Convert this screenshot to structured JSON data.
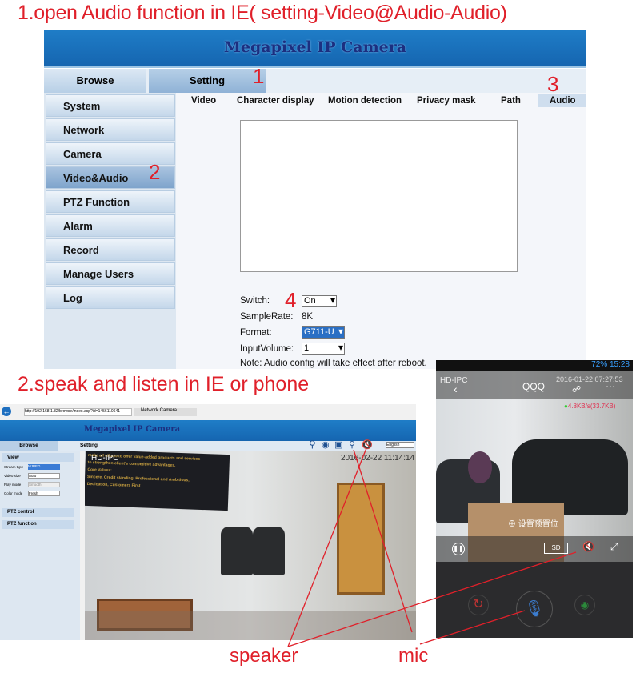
{
  "step1_title": "1.open Audio function in IE( setting-Video@Audio-Audio)",
  "step2_title": "2.speak and listen in IE or phone",
  "markers": [
    "1",
    "2",
    "3",
    "4"
  ],
  "app": {
    "title": "Megapixel IP Camera",
    "tabs": [
      "Browse",
      "Setting"
    ]
  },
  "sidebar": {
    "items": [
      "System",
      "Network",
      "Camera",
      "Video&Audio",
      "PTZ Function",
      "Alarm",
      "Record",
      "Manage Users",
      "Log"
    ],
    "active": "Video&Audio"
  },
  "subtabs": {
    "items": [
      "Video",
      "Character display",
      "Motion detection",
      "Privacy mask",
      "Path",
      "Audio"
    ],
    "active": "Audio"
  },
  "audio_form": {
    "switch_label": "Switch:",
    "switch_value": "On",
    "samplerate_label": "SampleRate:",
    "samplerate_value": "8K",
    "format_label": "Format:",
    "format_value": "G711-U",
    "volume_label": "InputVolume:",
    "volume_value": "1",
    "note": "Note: Audio config will take effect after reboot."
  },
  "browser": {
    "url": "http://192.168.1.32/browse/index.asp?id=1456110641",
    "tab_title": "Network Camera",
    "app_title": "Megapixel IP Camera",
    "tabs": [
      "Browse",
      "Setting"
    ],
    "language": "English",
    "view_label": "View",
    "fields": [
      {
        "label": "Stream type",
        "value": "MJPEG"
      },
      {
        "label": "Video size",
        "value": "Auto"
      },
      {
        "label": "Play mode",
        "value": "Smooth"
      },
      {
        "label": "Color mode",
        "value": "Fresh"
      }
    ],
    "ptz_control": "PTZ control",
    "ptz_function": "PTZ function",
    "osd_name": "HD-IPC",
    "osd_time": "2016-02-22  11:14:14",
    "board_text": [
      "make all efforts to offer value-added products and services",
      "to strengthen client's competitive advantages.",
      "Core Values:",
      "Sincere, Credit standing, Professional and Ambitious,",
      "Dedication, Customers First"
    ]
  },
  "phone": {
    "status": "72%  15:28",
    "osd_name": "HD-IPC",
    "title": "QQQ",
    "osd_time": "2016-01-22 07:27:53",
    "bitrate": "4.8KB/s(33.7KB)",
    "preset": "设置预置位",
    "quality": "SD"
  },
  "labels": {
    "speaker": "speaker",
    "mic": "mic"
  },
  "colors": {
    "annotation": "#e0202a",
    "banner": "#1f7dc7",
    "title_text": "#1c2f80"
  }
}
